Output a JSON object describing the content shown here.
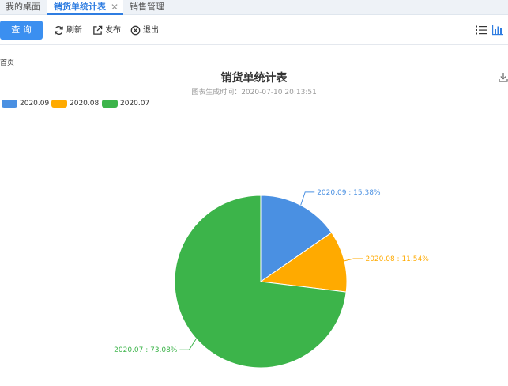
{
  "tabs": [
    {
      "label": "我的桌面",
      "active": false
    },
    {
      "label": "销货单统计表",
      "active": true
    },
    {
      "label": "销售管理",
      "active": false
    }
  ],
  "tab_close_glyph": "✕",
  "toolbar": {
    "query_label": "查 询",
    "refresh_label": "刷新",
    "publish_label": "发布",
    "exit_label": "退出"
  },
  "breadcrumb": "首页",
  "colors": {
    "accent": "#2f7de1",
    "blue": "#4a90e2",
    "orange": "#ffaa00",
    "green": "#3cb44a"
  },
  "chart_data": {
    "type": "pie",
    "title": "销货单统计表",
    "subtitle": "图表生成时间：2020-07-10 20:13:51",
    "legend_position": "top-left",
    "slices": [
      {
        "name": "2020.09",
        "value": 15.38,
        "label": "2020.09 : 15.38%",
        "color": "#4a90e2"
      },
      {
        "name": "2020.08",
        "value": 11.54,
        "label": "2020.08 : 11.54%",
        "color": "#ffaa00"
      },
      {
        "name": "2020.07",
        "value": 73.08,
        "label": "2020.07 : 73.08%",
        "color": "#3cb44a"
      }
    ]
  }
}
